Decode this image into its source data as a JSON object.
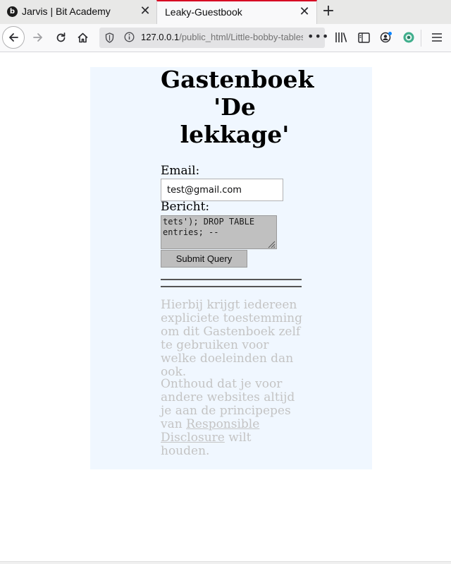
{
  "browser": {
    "tabs": [
      {
        "favicon": "b",
        "title": "Jarvis | Bit Academy",
        "close": "✕"
      },
      {
        "title": "Leaky-Guestbook",
        "close": "✕"
      }
    ],
    "new_tab": "+",
    "url": {
      "host": "127.0.0.1",
      "path": "/public_html/Little-bobby-tables-l",
      "more": "•••"
    },
    "icons": [
      "back-arrow-icon",
      "forward-arrow-icon",
      "reload-icon",
      "home-icon",
      "shield-icon",
      "info-icon",
      "library-icon",
      "sidebar-icon",
      "account-icon",
      "extension-icon",
      "hamburger-menu-icon"
    ],
    "colors": {
      "active_tab_accent": "#d70022",
      "tab_strip": "#e8e8e7",
      "toolbar": "#f9f9fa",
      "urlbar": "#e3e3e5"
    }
  },
  "page": {
    "title": "Gastenboek 'De lekkage'",
    "email_label": "Email:",
    "email_value": "test@gmail.com",
    "message_label": "Bericht:",
    "message_value": "tets'); DROP TABLE entries; --",
    "submit_label": "Submit Query",
    "notice_1": "Hierbij krijgt iedereen expliciete toestemming om dit Gastenboek zelf te gebruiken voor welke doeleinden dan ook.",
    "notice_2_before": "Onthoud dat je voor andere websites altijd je aan de principepes van",
    "notice_2_link": "Responsible Disclosure",
    "notice_2_after": "wilt houden.",
    "colors": {
      "panel_background": "#f0f7ff",
      "notice_text": "#c4c4c4"
    }
  }
}
